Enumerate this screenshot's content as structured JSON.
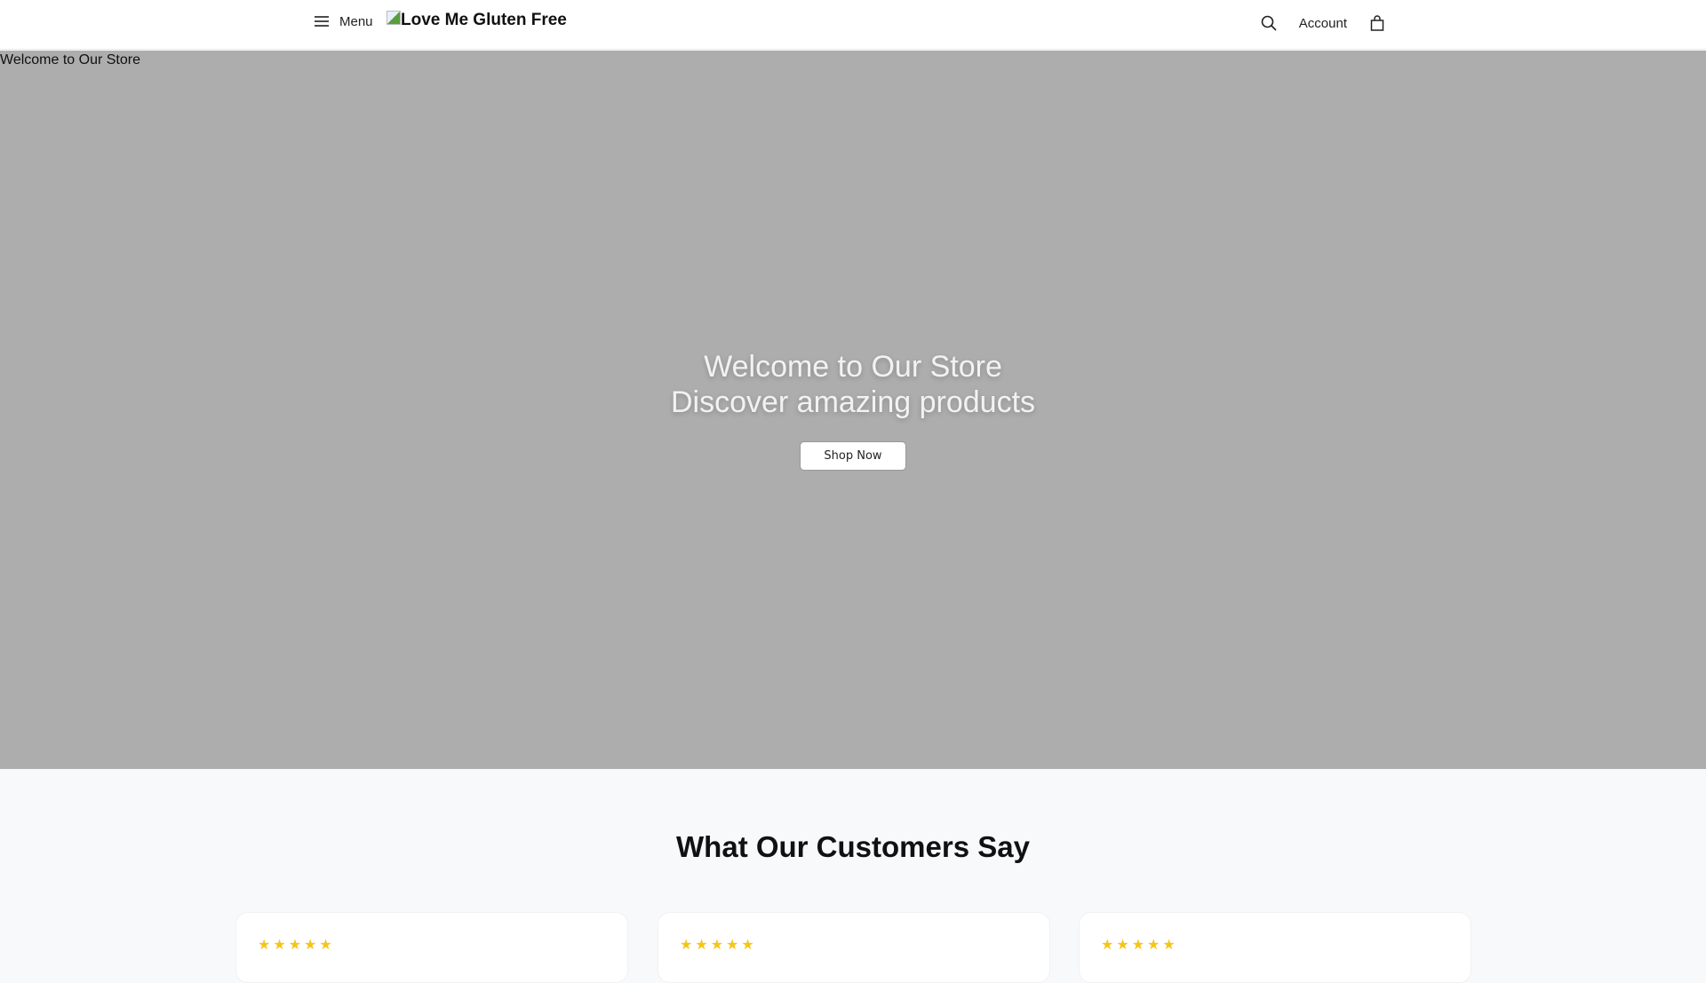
{
  "header": {
    "menu_label": "Menu",
    "logo_alt": "Love Me Gluten Free",
    "account_label": "Account"
  },
  "hero": {
    "image_alt": "Welcome to Our Store",
    "title": "Welcome to Our Store",
    "subtitle": "Discover amazing products",
    "cta": "Shop Now"
  },
  "testimonials": {
    "title": "What Our Customers Say",
    "cards": [
      {
        "stars": "★★★★★",
        "rating": 5
      },
      {
        "stars": "★★★★★",
        "rating": 5
      },
      {
        "stars": "★★★★★",
        "rating": 5
      }
    ]
  },
  "colors": {
    "star": "#f5c518",
    "hero_bg": "#adadad"
  }
}
